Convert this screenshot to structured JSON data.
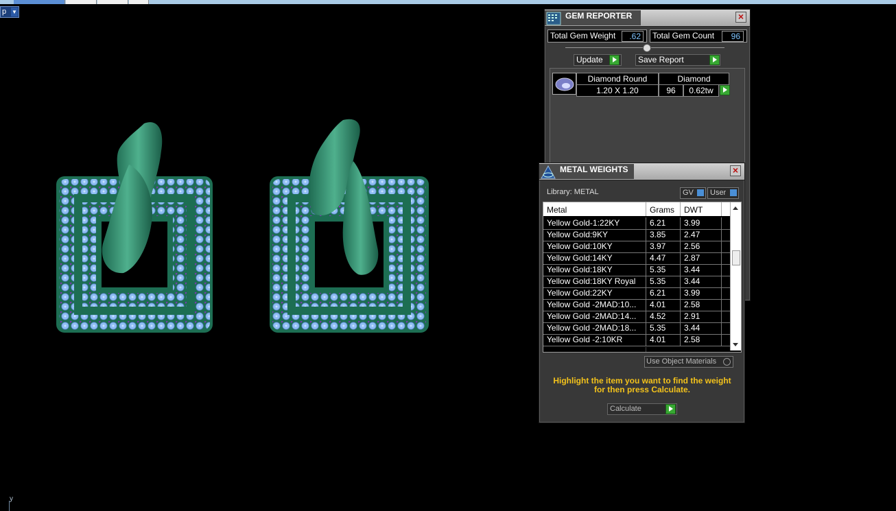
{
  "viewport": {
    "menu_label": "p",
    "axis_label": "y"
  },
  "gem_reporter": {
    "title": "GEM REPORTER",
    "total_weight_label": "Total Gem Weight",
    "total_weight_value": ".62",
    "total_count_label": "Total Gem Count",
    "total_count_value": "96",
    "update_label": "Update",
    "save_report_label": "Save Report",
    "gem": {
      "shape": "Diamond Round",
      "material": "Diamond",
      "size": "1.20 X 1.20",
      "count": "96",
      "weight": "0.62tw"
    }
  },
  "metal_weights": {
    "title": "METAL WEIGHTS",
    "library_label": "Library: METAL",
    "gv_label": "GV",
    "user_label": "User",
    "columns": [
      "Metal",
      "Grams",
      "DWT"
    ],
    "rows": [
      [
        "Yellow Gold-1:22KY",
        "6.21",
        "3.99"
      ],
      [
        "Yellow Gold:9KY",
        "3.85",
        "2.47"
      ],
      [
        "Yellow Gold:10KY",
        "3.97",
        "2.56"
      ],
      [
        "Yellow Gold:14KY",
        "4.47",
        "2.87"
      ],
      [
        "Yellow Gold:18KY",
        "5.35",
        "3.44"
      ],
      [
        "Yellow Gold:18KY Royal",
        "5.35",
        "3.44"
      ],
      [
        "Yellow Gold:22KY",
        "6.21",
        "3.99"
      ],
      [
        "Yellow Gold -2MAD:10...",
        "4.01",
        "2.58"
      ],
      [
        "Yellow Gold -2MAD:14...",
        "4.52",
        "2.91"
      ],
      [
        "Yellow Gold -2MAD:18...",
        "5.35",
        "3.44"
      ],
      [
        "Yellow Gold -2:10KR",
        "4.01",
        "2.58"
      ]
    ],
    "use_object_materials_label": "Use Object Materials",
    "hint_line1": "Highlight the item you want to find the weight",
    "hint_line2": "for then press Calculate.",
    "calculate_label": "Calculate"
  },
  "colors": {
    "ribbon": "#2f8a6a",
    "gem_blue": "#8fbff5",
    "gem_purple": "#7a3ab0",
    "panel_bg": "#3a3a3a",
    "play_green": "#37a832",
    "hint_yellow": "#f3c21b"
  }
}
